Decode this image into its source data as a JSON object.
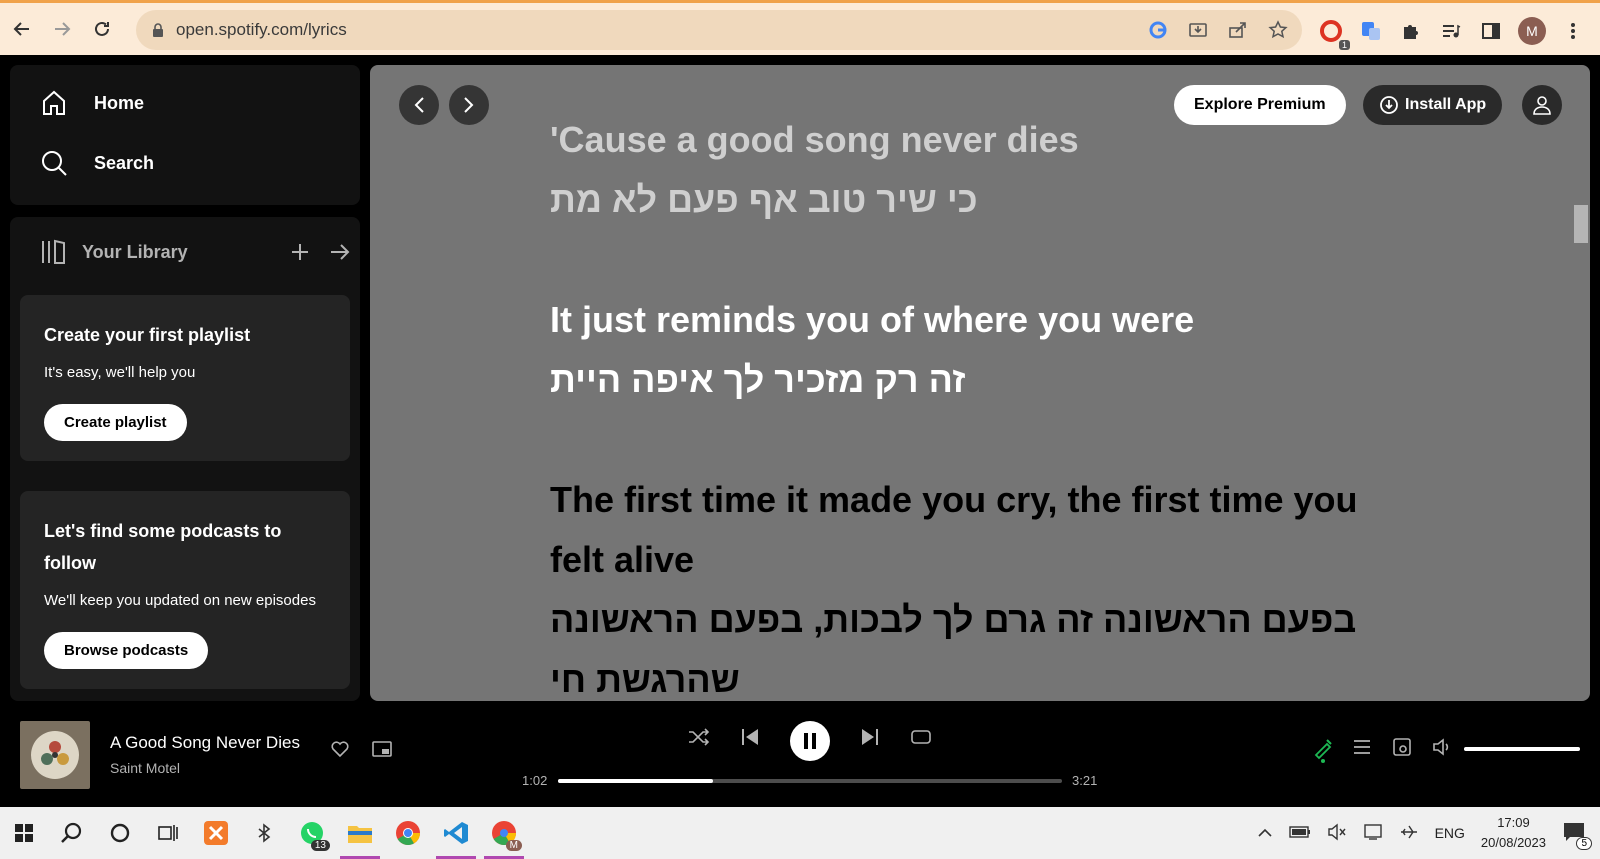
{
  "browser": {
    "url": "open.spotify.com/lyrics",
    "avatar_letter": "M",
    "ext_badge": "1"
  },
  "sidebar": {
    "nav": [
      {
        "label": "Home"
      },
      {
        "label": "Search"
      }
    ],
    "library_title": "Your Library",
    "cards": [
      {
        "title": "Create your first playlist",
        "text": "It's easy, we'll help you",
        "button": "Create playlist"
      },
      {
        "title": "Let's find some podcasts to follow",
        "text": "We'll keep you updated on new episodes",
        "button": "Browse podcasts"
      }
    ]
  },
  "header": {
    "explore_label": "Explore Premium",
    "install_label": "Install App"
  },
  "lyrics": {
    "past_en": "'Cause a good song never dies",
    "past_he": "כי שיר טוב אף פעם לא מת",
    "current_en": "It just reminds you of where you were",
    "current_he": "זה רק מזכיר לך איפה היית",
    "next_en": "The first time it made you cry, the first time you felt alive",
    "next_he": "בפעם הראשונה זה גרם לך לבכות, בפעם הראשונה שהרגשת חי"
  },
  "player": {
    "title": "A Good Song Never Dies",
    "artist": "Saint Motel",
    "elapsed": "1:02",
    "duration": "3:21",
    "progress_fraction": 0.308,
    "volume_fraction": 1.0
  },
  "taskbar": {
    "whatsapp_badge": "13",
    "chrome_badge_letter": "M",
    "language": "ENG",
    "time": "17:09",
    "date": "20/08/2023",
    "notifications": "5"
  },
  "colors": {
    "accent_green": "#1db954",
    "lyrics_bg": "#757575"
  }
}
